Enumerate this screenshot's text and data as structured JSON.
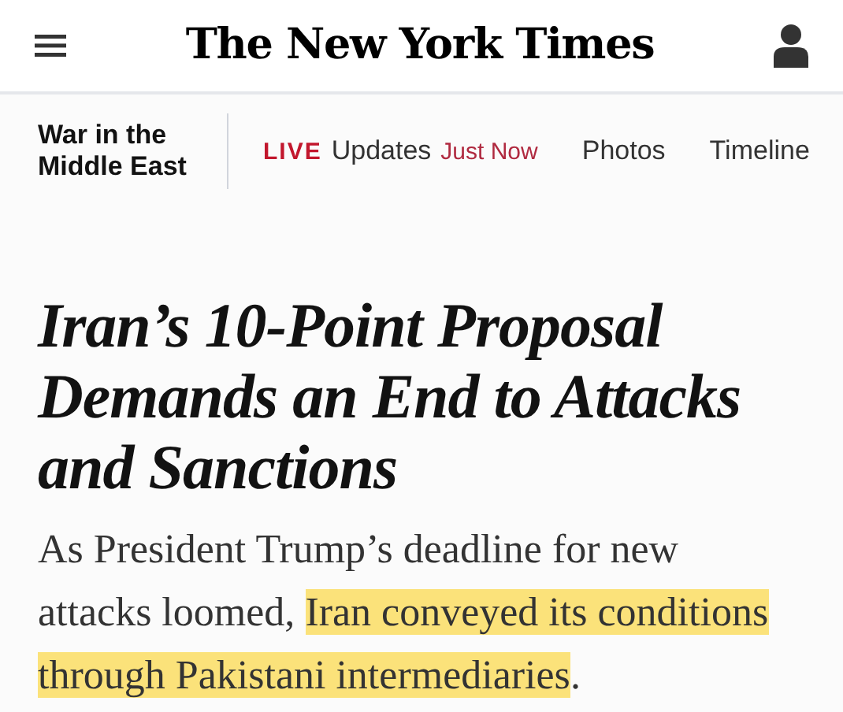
{
  "masthead": {
    "logo": "The New York Times"
  },
  "section_nav": {
    "title": "War in the Middle East",
    "links": [
      {
        "kind": "live",
        "badge": "LIVE",
        "label": "Updates",
        "time": "Just Now"
      },
      {
        "kind": "plain",
        "label": "Photos"
      },
      {
        "kind": "plain",
        "label": "Timeline"
      }
    ]
  },
  "article": {
    "headline": "Iran’s 10-Point Proposal Demands an End to Attacks and Sanctions",
    "summary": [
      {
        "text": "As President Trump’s deadline for new attacks loomed, ",
        "highlighted": false
      },
      {
        "text": "Iran conveyed its conditions through Pakistani intermediaries",
        "highlighted": true
      },
      {
        "text": ".",
        "highlighted": false
      }
    ]
  }
}
